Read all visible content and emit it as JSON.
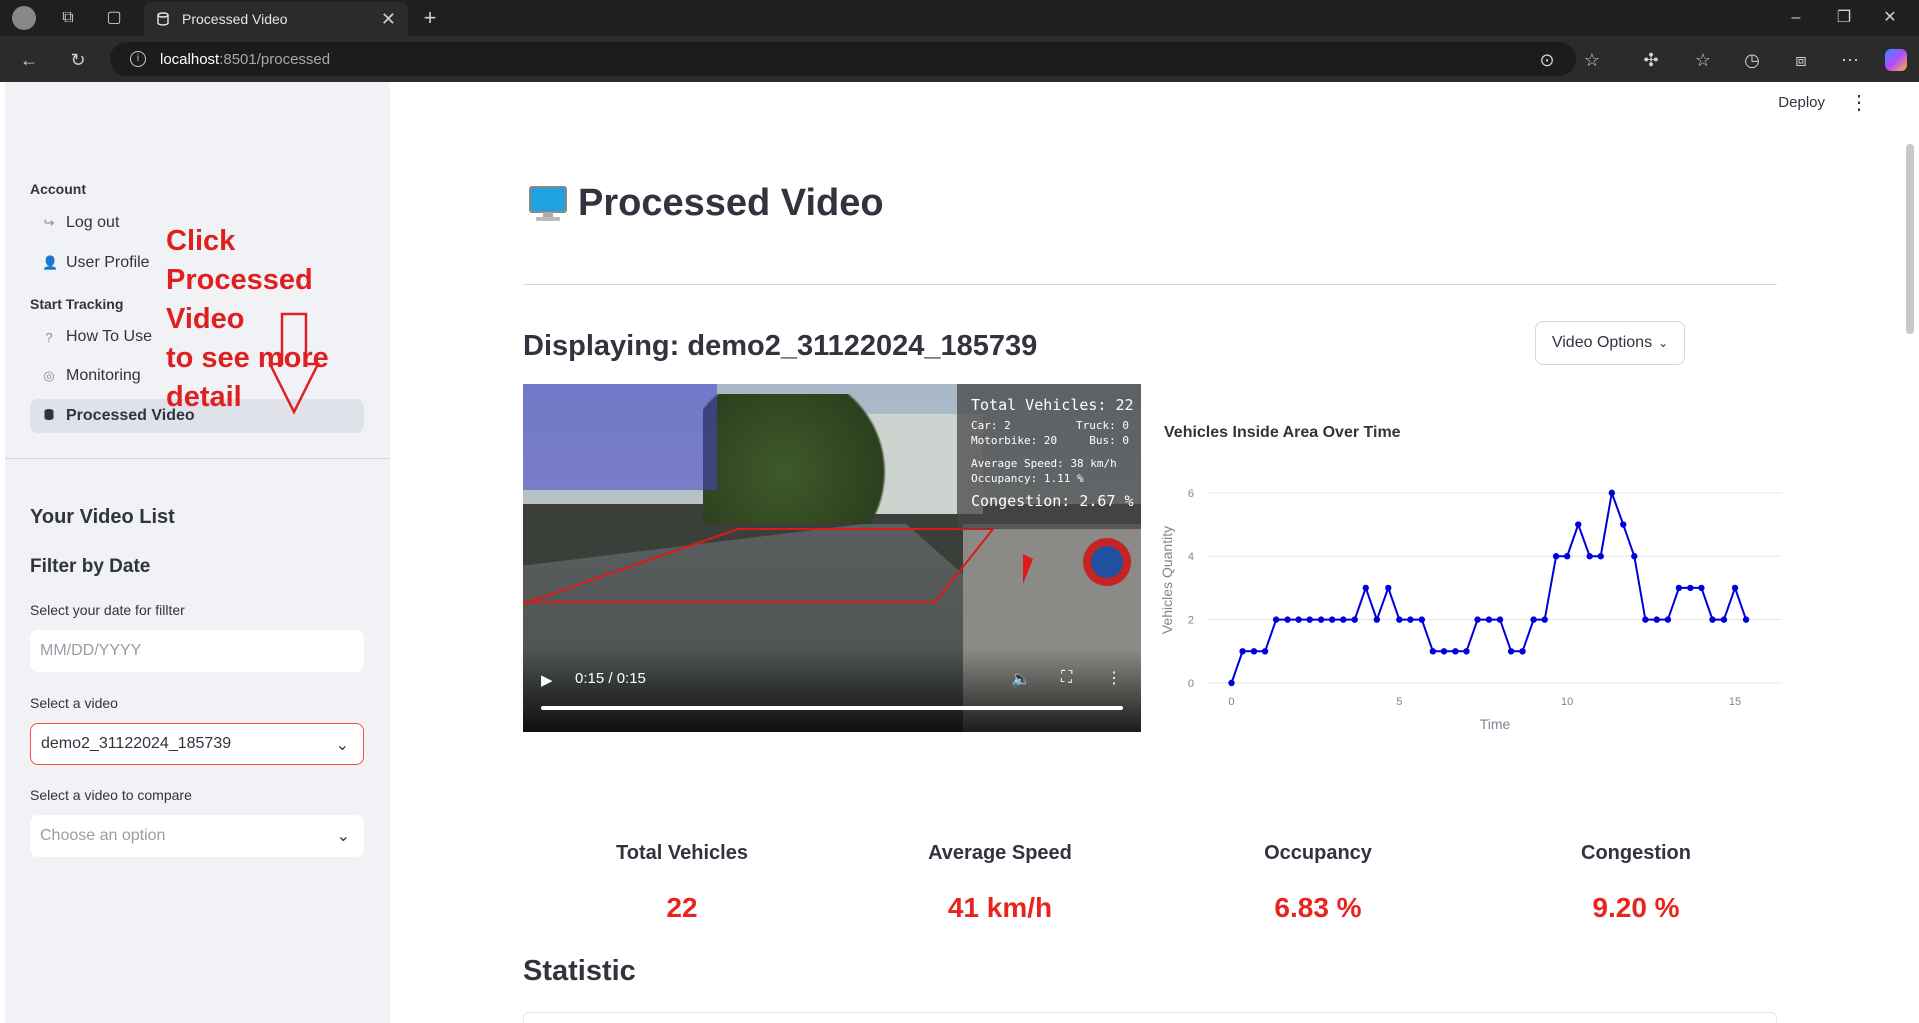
{
  "browser": {
    "tab_title": "Processed Video",
    "url_host": "localhost",
    "url_path": ":8501/processed"
  },
  "sidebar": {
    "account_heading": "Account",
    "items_account": [
      {
        "label": "Log out",
        "icon": "logout-icon"
      },
      {
        "label": "User Profile",
        "icon": "user-icon"
      }
    ],
    "tracking_heading": "Start Tracking",
    "items_tracking": [
      {
        "label": "How To Use",
        "icon": "help-icon"
      },
      {
        "label": "Monitoring",
        "icon": "camera-icon"
      },
      {
        "label": "Processed Video",
        "icon": "database-icon"
      }
    ],
    "video_list_heading": "Your Video List",
    "filter_heading": "Filter by Date",
    "date_label": "Select your date for fillter",
    "date_placeholder": "MM/DD/YYYY",
    "video_label": "Select a video",
    "video_value": "demo2_31122024_185739",
    "compare_label": "Select a video to compare",
    "compare_placeholder": "Choose an option"
  },
  "annotation": {
    "line1": "Click Processed Video",
    "line2": "to see more detail",
    "color": "#e02020"
  },
  "header": {
    "deploy_label": "Deploy"
  },
  "main": {
    "title": "Processed Video",
    "displaying": "Displaying: demo2_31122024_185739",
    "video_options_label": "Video Options",
    "video": {
      "overlay_total": "Total Vehicles: 22",
      "overlay_car": "Car: 2",
      "overlay_truck": "Truck: 0",
      "overlay_motorbike": "Motorbike: 20",
      "overlay_bus": "Bus: 0",
      "overlay_speed": "Average Speed: 38 km/h",
      "overlay_occupancy": "Occupancy: 1.11 %",
      "overlay_congestion": "Congestion: 2.67 %",
      "time": "0:15 / 0:15",
      "progress": 1.0
    },
    "chart_title": "Vehicles Inside Area Over Time",
    "metrics": [
      {
        "label": "Total Vehicles",
        "value": "22"
      },
      {
        "label": "Average Speed",
        "value": "41 km/h"
      },
      {
        "label": "Occupancy",
        "value": "6.83 %"
      },
      {
        "label": "Congestion",
        "value": "9.20 %"
      }
    ],
    "metric_color": "#e8241f",
    "statistic_heading": "Statistic"
  },
  "chart_data": {
    "type": "line",
    "title": "Vehicles Inside Area Over Time",
    "xlabel": "Time",
    "ylabel": "Vehicles Quantity",
    "xlim": [
      -0.7,
      16.4
    ],
    "ylim": [
      0,
      6.5
    ],
    "x_ticks": [
      0,
      5,
      10,
      15
    ],
    "y_ticks": [
      0,
      2,
      4,
      6
    ],
    "grid": true,
    "color": "#0000dd",
    "x": [
      0,
      0.33,
      0.67,
      1,
      1.33,
      1.67,
      2,
      2.33,
      2.67,
      3,
      3.33,
      3.67,
      4,
      4.33,
      4.67,
      5,
      5.33,
      5.67,
      6,
      6.33,
      6.67,
      7,
      7.33,
      7.67,
      8,
      8.33,
      8.67,
      9,
      9.33,
      9.67,
      10,
      10.33,
      10.67,
      11,
      11.33,
      11.67,
      12,
      12.33,
      12.67,
      13,
      13.33,
      13.67,
      14,
      14.33,
      14.67,
      15,
      15.33
    ],
    "values": [
      0,
      1,
      1,
      1,
      2,
      2,
      2,
      2,
      2,
      2,
      2,
      2,
      3,
      2,
      3,
      2,
      2,
      2,
      1,
      1,
      1,
      1,
      2,
      2,
      2,
      1,
      1,
      2,
      2,
      4,
      4,
      5,
      4,
      4,
      6,
      5,
      4,
      2,
      2,
      2,
      3,
      3,
      3,
      2,
      2,
      3,
      2
    ]
  }
}
